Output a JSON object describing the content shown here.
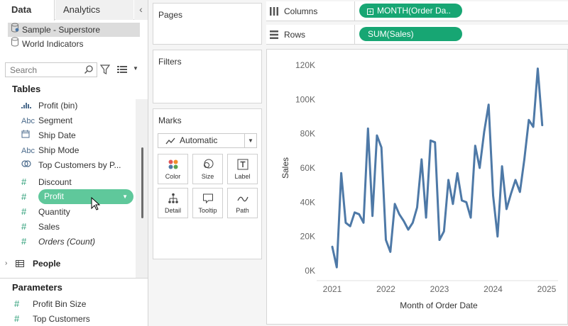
{
  "tabs": {
    "data": "Data",
    "analytics": "Analytics",
    "collapse_icon": "chevron-left-icon"
  },
  "datasources": [
    {
      "label": "Sample - Superstore",
      "icon": "database-icon",
      "selected": true
    },
    {
      "label": "World Indicators",
      "icon": "database-icon",
      "selected": false
    }
  ],
  "search": {
    "placeholder": "Search",
    "value": ""
  },
  "tables_header": "Tables",
  "fields": [
    {
      "label": "Profit (bin)",
      "icon": "bin-histogram-icon",
      "glyph": ".ıl.",
      "measure": false,
      "italic": false
    },
    {
      "label": "Segment",
      "icon": "string-type-icon",
      "glyph": "Abc",
      "measure": false,
      "italic": false
    },
    {
      "label": "Ship Date",
      "icon": "calendar-icon",
      "glyph": "",
      "measure": false,
      "italic": false
    },
    {
      "label": "Ship Mode",
      "icon": "string-type-icon",
      "glyph": "Abc",
      "measure": false,
      "italic": false
    },
    {
      "label": "Top Customers by P...",
      "icon": "set-icon",
      "glyph": "",
      "measure": false,
      "italic": false
    },
    {
      "label": "Discount",
      "icon": "number-type-icon",
      "glyph": "#",
      "measure": true,
      "italic": false
    },
    {
      "label": "Profit",
      "icon": "number-type-icon",
      "glyph": "#",
      "measure": true,
      "italic": false,
      "dragging": true
    },
    {
      "label": "Quantity",
      "icon": "number-type-icon",
      "glyph": "#",
      "measure": true,
      "italic": false
    },
    {
      "label": "Sales",
      "icon": "number-type-icon",
      "glyph": "#",
      "measure": true,
      "italic": false
    },
    {
      "label": "Orders (Count)",
      "icon": "number-type-icon",
      "glyph": "#",
      "measure": true,
      "italic": true
    }
  ],
  "people": {
    "label": "People",
    "icon": "table-icon"
  },
  "parameters_header": "Parameters",
  "parameters": [
    {
      "label": "Profit Bin Size",
      "glyph": "#"
    },
    {
      "label": "Top Customers",
      "glyph": "#"
    }
  ],
  "cards": {
    "pages": "Pages",
    "filters": "Filters",
    "marks": "Marks"
  },
  "marks": {
    "type": "Automatic",
    "buttons": [
      {
        "label": "Color",
        "icon": "color-dots-icon"
      },
      {
        "label": "Size",
        "icon": "size-circles-icon"
      },
      {
        "label": "Label",
        "icon": "label-T-icon"
      },
      {
        "label": "Detail",
        "icon": "detail-hierarchy-icon"
      },
      {
        "label": "Tooltip",
        "icon": "tooltip-bubble-icon"
      },
      {
        "label": "Path",
        "icon": "path-line-icon"
      }
    ]
  },
  "shelves": {
    "columns_label": "Columns",
    "columns_pill": "MONTH(Order Da..",
    "rows_label": "Rows",
    "rows_pill": "SUM(Sales)"
  },
  "colors": {
    "accent_pill": "#17a673",
    "drag_pill": "#5fc89b",
    "line": "#4e79a7"
  },
  "chart_data": {
    "type": "line",
    "title": "",
    "xlabel": "Month of Order Date",
    "ylabel": "Sales",
    "x_ticks": [
      "2021",
      "2022",
      "2023",
      "2024",
      "2025"
    ],
    "y_ticks": [
      "0K",
      "20K",
      "40K",
      "60K",
      "80K",
      "100K",
      "120K"
    ],
    "ylim": [
      0,
      120000
    ],
    "xlim": [
      "2021-01",
      "2025-01"
    ],
    "grid": false,
    "series": [
      {
        "name": "",
        "x": [
          "2021-01",
          "2021-02",
          "2021-03",
          "2021-04",
          "2021-05",
          "2021-06",
          "2021-07",
          "2021-08",
          "2021-09",
          "2021-10",
          "2021-11",
          "2021-12",
          "2022-01",
          "2022-02",
          "2022-03",
          "2022-04",
          "2022-05",
          "2022-06",
          "2022-07",
          "2022-08",
          "2022-09",
          "2022-10",
          "2022-11",
          "2022-12",
          "2023-01",
          "2023-02",
          "2023-03",
          "2023-04",
          "2023-05",
          "2023-06",
          "2023-07",
          "2023-08",
          "2023-09",
          "2023-10",
          "2023-11",
          "2023-12",
          "2024-01",
          "2024-02",
          "2024-03",
          "2024-04",
          "2024-05",
          "2024-06",
          "2024-07",
          "2024-08",
          "2024-09",
          "2024-10",
          "2024-11",
          "2024-12",
          "2025-01"
        ],
        "y": [
          14000,
          2000,
          57000,
          28000,
          26000,
          34000,
          33000,
          28000,
          83000,
          32000,
          79000,
          72000,
          18000,
          11000,
          39000,
          33000,
          29000,
          24000,
          28000,
          37000,
          65000,
          31000,
          76000,
          75000,
          18000,
          23000,
          53000,
          39000,
          57000,
          41000,
          40000,
          31000,
          73000,
          60000,
          81000,
          97000,
          44000,
          20000,
          61000,
          36000,
          45000,
          53000,
          46000,
          65000,
          88000,
          84000,
          118000,
          85000,
          null
        ]
      }
    ]
  }
}
